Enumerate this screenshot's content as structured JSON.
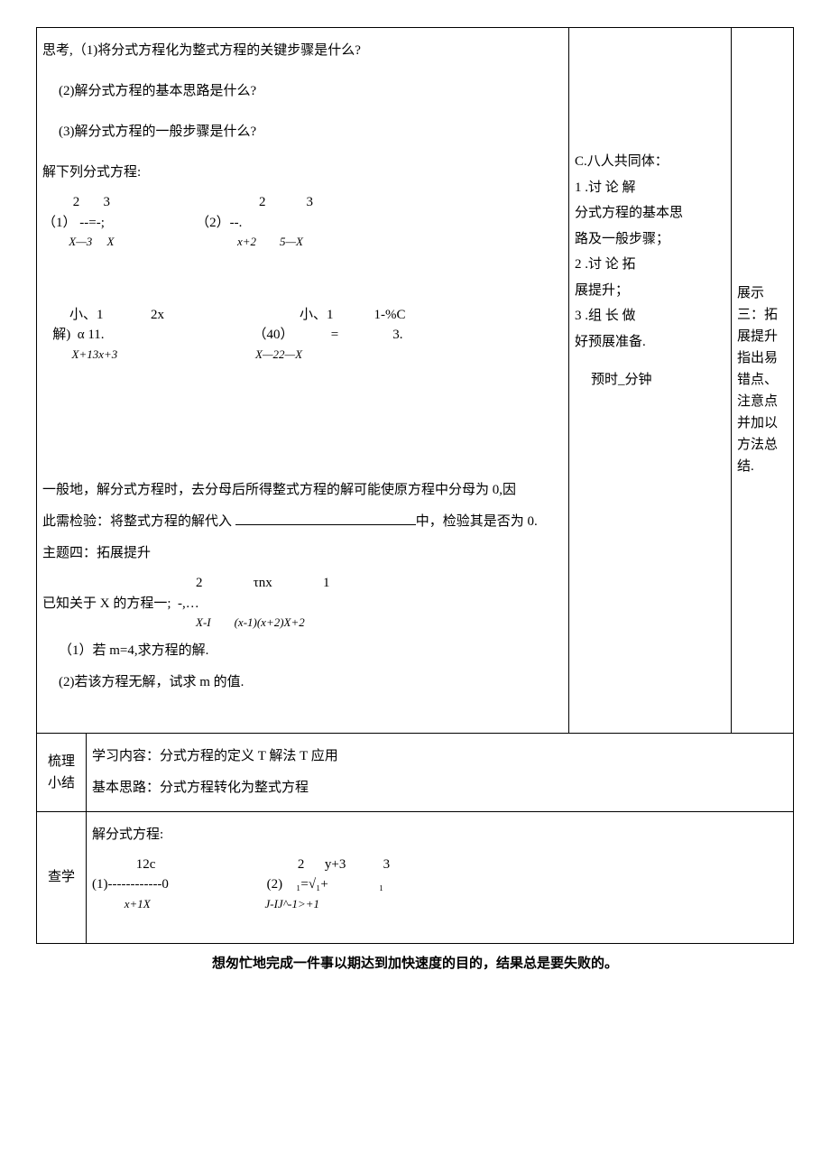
{
  "main": {
    "think_title": "思考,（1)将分式方程化为整式方程的关键步骤是什么?",
    "think_q2": "(2)解分式方程的基本思路是什么?",
    "think_q3": "(3)解分式方程的一般步骤是什么?",
    "solve_title": "解下列分式方程:",
    "eq1": {
      "l1": "         2       3                                            2            3",
      "l2": "（1） --=-;                           （2）--.",
      "l3": "         X—3     X                                          x+2        5—X"
    },
    "eq2": {
      "l1": "        小、1              2x                                        小、1            1-%C",
      "l2": "   解)  α 11.                                            （40）           =                3.",
      "l3": "          X+13x+3                                               X—22—X"
    },
    "general_note_a": "一般地，解分式方程时，去分母后所得整式方程的解可能使原方程中分母为 0,因",
    "general_note_b_pre": "此需检验：将整式方程的解代入 ",
    "general_note_b_post": "中，检验其是否为 0.",
    "topic4": "主题四：拓展提升",
    "known_pre": "已知关于 X 的方程一;  -,…",
    "known_eq_top": "2               τnx               1",
    "known_eq_bot": "X-I        (x-1)(x+2)X+2",
    "q1": "（1）若 m=4,求方程的解.",
    "q2": "(2)若该方程无解，试求 m 的值."
  },
  "side": {
    "c_title": "C.八人共同体：",
    "c1a": "1             .讨 论 解",
    "c1b": "分式方程的基本思",
    "c1c": "路及一般步骤；",
    "c2a": "2             .讨 论 拓",
    "c2b": "展提升；",
    "c3a": "3             .组 长 做",
    "c3b": "好预展准备.",
    "timer": "预时_分钟"
  },
  "right": {
    "show3": "展示三：拓展提升指出易错点、注意点并加以方法总结."
  },
  "summary": {
    "label": "梳理小结",
    "line1": "学习内容：分式方程的定义 T 解法 T 应用",
    "line2": "基本思路：分式方程转化为整式方程"
  },
  "check": {
    "label": "查学",
    "title": "解分式方程:",
    "eq": {
      "l1": "             12c                                          2      y+3           3",
      "l2": "(1)------------0                             (2)    ₁=√₁+               ₁",
      "l3": "           x+1X                                       J-IJ^-1>+1"
    }
  },
  "footer": "想匆忙地完成一件事以期达到加快速度的目的，结果总是要失败的。"
}
